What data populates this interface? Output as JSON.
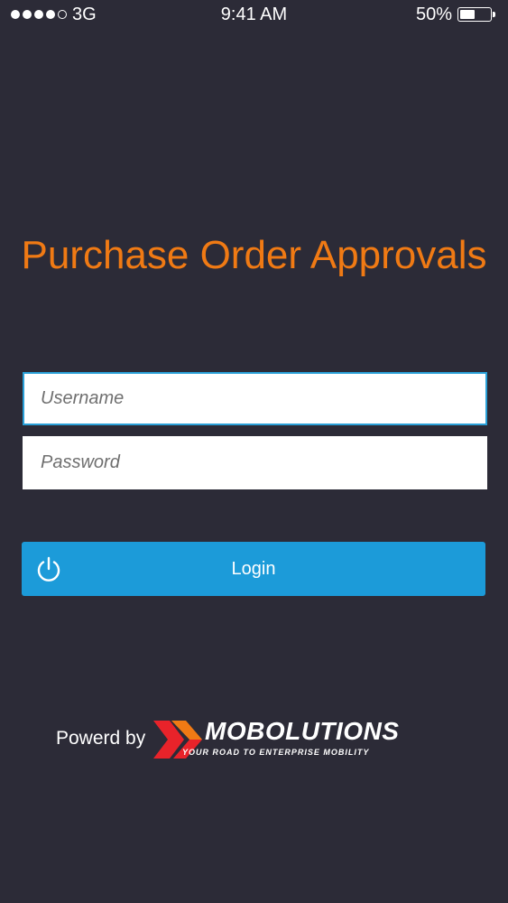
{
  "status_bar": {
    "signal_dots_filled": 4,
    "signal_dots_total": 5,
    "carrier": "3G",
    "time": "9:41 AM",
    "battery_percent_text": "50%",
    "battery_level": 0.5
  },
  "app": {
    "title": "Purchase Order Approvals",
    "title_color": "#f07a14",
    "background_color": "#2c2b37"
  },
  "form": {
    "username_placeholder": "Username",
    "username_value": "",
    "password_placeholder": "Password",
    "password_value": "",
    "login_label": "Login",
    "login_icon": "power-icon",
    "accent_color": "#1c9bd9"
  },
  "footer": {
    "powered_by": "Powerd by",
    "brand_name": "MOBOLUTIONS",
    "tagline": "YOUR ROAD TO ENTERPRISE MOBILITY",
    "logo_icon": "mobolutions-chevron-logo",
    "logo_colors": [
      "#e8232a",
      "#f07a14"
    ]
  }
}
